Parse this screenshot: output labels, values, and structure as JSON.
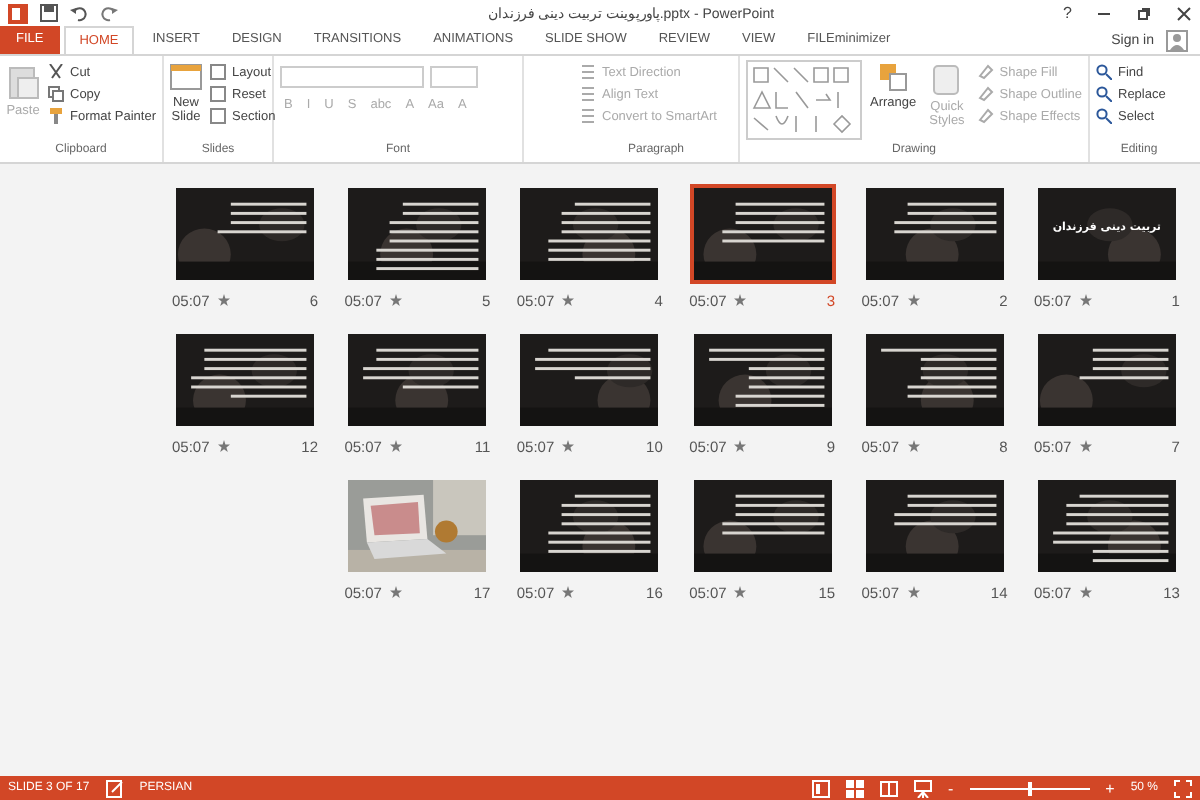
{
  "window": {
    "title": "پاورپوینت تربیت دینی فرزندان.pptx - PowerPoint",
    "sign_in": "Sign in",
    "help": "?"
  },
  "tabs": [
    {
      "label": "FILE",
      "kind": "file",
      "selected": false
    },
    {
      "label": "HOME",
      "kind": "tab",
      "selected": true
    },
    {
      "label": "INSERT",
      "kind": "tab",
      "selected": false
    },
    {
      "label": "DESIGN",
      "kind": "tab",
      "selected": false
    },
    {
      "label": "TRANSITIONS",
      "kind": "tab",
      "selected": false
    },
    {
      "label": "ANIMATIONS",
      "kind": "tab",
      "selected": false
    },
    {
      "label": "SLIDE SHOW",
      "kind": "tab",
      "selected": false
    },
    {
      "label": "REVIEW",
      "kind": "tab",
      "selected": false
    },
    {
      "label": "VIEW",
      "kind": "tab",
      "selected": false
    },
    {
      "label": "FILEminimizer",
      "kind": "tab",
      "selected": false
    }
  ],
  "ribbon": {
    "clipboard": {
      "label": "Clipboard",
      "paste": {
        "label": "Paste",
        "disabled": true
      },
      "items": [
        {
          "label": "Cut",
          "disabled": false
        },
        {
          "label": "Copy",
          "disabled": false
        },
        {
          "label": "Format Painter",
          "disabled": false
        }
      ]
    },
    "slides": {
      "label": "Slides",
      "new_slide": "New Slide",
      "items": [
        {
          "label": "Layout"
        },
        {
          "label": "Reset"
        },
        {
          "label": "Section"
        }
      ]
    },
    "font": {
      "label": "Font",
      "buttons": [
        "B",
        "I",
        "U",
        "S",
        "abc",
        "A",
        "Aa",
        "A"
      ]
    },
    "paragraph": {
      "label": "Paragraph",
      "items": [
        {
          "label": "Text Direction",
          "disabled": true
        },
        {
          "label": "Align Text",
          "disabled": true
        },
        {
          "label": "Convert to SmartArt",
          "disabled": true
        }
      ]
    },
    "drawing": {
      "label": "Drawing",
      "arrange": "Arrange",
      "quick_styles": {
        "label": "Quick Styles",
        "disabled": true
      },
      "items": [
        {
          "label": "Shape Fill",
          "disabled": true
        },
        {
          "label": "Shape Outline",
          "disabled": true
        },
        {
          "label": "Shape Effects",
          "disabled": true
        }
      ]
    },
    "editing": {
      "label": "Editing",
      "items": [
        {
          "label": "Find"
        },
        {
          "label": "Replace"
        },
        {
          "label": "Select"
        }
      ]
    }
  },
  "slides": [
    {
      "number": "6",
      "time": "05:07",
      "selected": false,
      "kind": "text"
    },
    {
      "number": "5",
      "time": "05:07",
      "selected": false,
      "kind": "text"
    },
    {
      "number": "4",
      "time": "05:07",
      "selected": false,
      "kind": "text"
    },
    {
      "number": "3",
      "time": "05:07",
      "selected": true,
      "kind": "text"
    },
    {
      "number": "2",
      "time": "05:07",
      "selected": false,
      "kind": "text"
    },
    {
      "number": "1",
      "time": "05:07",
      "selected": false,
      "kind": "title",
      "title": "تربیت دینی فرزندان"
    },
    {
      "number": "12",
      "time": "05:07",
      "selected": false,
      "kind": "text"
    },
    {
      "number": "11",
      "time": "05:07",
      "selected": false,
      "kind": "text"
    },
    {
      "number": "10",
      "time": "05:07",
      "selected": false,
      "kind": "text"
    },
    {
      "number": "9",
      "time": "05:07",
      "selected": false,
      "kind": "text"
    },
    {
      "number": "8",
      "time": "05:07",
      "selected": false,
      "kind": "text"
    },
    {
      "number": "7",
      "time": "05:07",
      "selected": false,
      "kind": "text"
    },
    {
      "number": "17",
      "time": "05:07",
      "selected": false
    },
    {
      "number": "16",
      "time": "05:07",
      "selected": false,
      "kind": "text"
    },
    {
      "number": "15",
      "time": "05:07",
      "selected": false,
      "kind": "text"
    },
    {
      "number": "14",
      "time": "05:07",
      "selected": false,
      "kind": "text"
    },
    {
      "number": "13",
      "time": "05:07",
      "selected": false,
      "kind": "text"
    }
  ],
  "status_bar": {
    "slide": "SLIDE 3 OF 17",
    "language": "PERSIAN",
    "zoom": "50 %",
    "zoom_out": "-",
    "zoom_in": "+",
    "zoom_level": {
      "level": 0.5
    }
  }
}
